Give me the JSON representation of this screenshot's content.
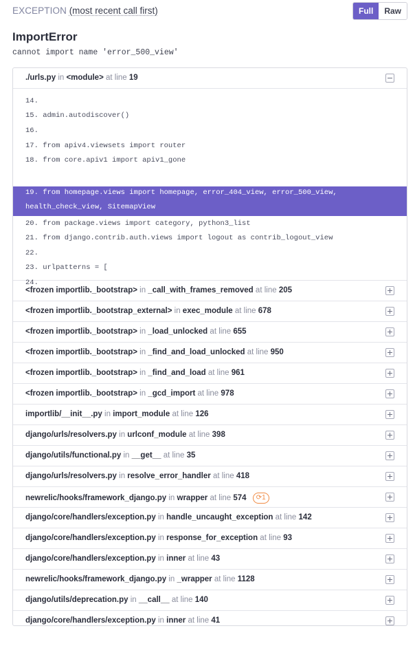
{
  "header": {
    "exception_label": "EXCEPTION",
    "sub_label": "(most recent call first)",
    "toggle_full": "Full",
    "toggle_raw": "Raw"
  },
  "error": {
    "type": "ImportError",
    "message": "cannot import name 'error_500_view'"
  },
  "colors": {
    "accent": "#6c5fc7",
    "badge": "#f08a43",
    "border": "#d9dae0"
  },
  "frames": [
    {
      "file": "./urls.py",
      "in": "in",
      "func": "<module>",
      "at": "at line",
      "line": "19",
      "expanded": true
    },
    {
      "file": "<frozen importlib._bootstrap>",
      "in": "in",
      "func": "_call_with_frames_removed",
      "at": "at line",
      "line": "205"
    },
    {
      "file": "<frozen importlib._bootstrap_external>",
      "in": "in",
      "func": "exec_module",
      "at": "at line",
      "line": "678"
    },
    {
      "file": "<frozen importlib._bootstrap>",
      "in": "in",
      "func": "_load_unlocked",
      "at": "at line",
      "line": "655"
    },
    {
      "file": "<frozen importlib._bootstrap>",
      "in": "in",
      "func": "_find_and_load_unlocked",
      "at": "at line",
      "line": "950"
    },
    {
      "file": "<frozen importlib._bootstrap>",
      "in": "in",
      "func": "_find_and_load",
      "at": "at line",
      "line": "961"
    },
    {
      "file": "<frozen importlib._bootstrap>",
      "in": "in",
      "func": "_gcd_import",
      "at": "at line",
      "line": "978"
    },
    {
      "file": "importlib/__init__.py",
      "in": "in",
      "func": "import_module",
      "at": "at line",
      "line": "126"
    },
    {
      "file": "django/urls/resolvers.py",
      "in": "in",
      "func": "urlconf_module",
      "at": "at line",
      "line": "398"
    },
    {
      "file": "django/utils/functional.py",
      "in": "in",
      "func": "__get__",
      "at": "at line",
      "line": "35"
    },
    {
      "file": "django/urls/resolvers.py",
      "in": "in",
      "func": "resolve_error_handler",
      "at": "at line",
      "line": "418"
    },
    {
      "file": "newrelic/hooks/framework_django.py",
      "in": "in",
      "func": "wrapper",
      "at": "at line",
      "line": "574",
      "badge": "1"
    },
    {
      "file": "django/core/handlers/exception.py",
      "in": "in",
      "func": "handle_uncaught_exception",
      "at": "at line",
      "line": "142"
    },
    {
      "file": "django/core/handlers/exception.py",
      "in": "in",
      "func": "response_for_exception",
      "at": "at line",
      "line": "93"
    },
    {
      "file": "django/core/handlers/exception.py",
      "in": "in",
      "func": "inner",
      "at": "at line",
      "line": "43"
    },
    {
      "file": "newrelic/hooks/framework_django.py",
      "in": "in",
      "func": "_wrapper",
      "at": "at line",
      "line": "1128"
    },
    {
      "file": "django/utils/deprecation.py",
      "in": "in",
      "func": "__call__",
      "at": "at line",
      "line": "140"
    },
    {
      "file": "django/core/handlers/exception.py",
      "in": "in",
      "func": "inner",
      "at": "at line",
      "line": "41"
    }
  ],
  "code": {
    "lines": [
      "14.",
      "15. admin.autodiscover()",
      "16.",
      "17. from apiv4.viewsets import router",
      "18. from core.apiv1 import apiv1_gone"
    ],
    "active_line_a": "19. from homepage.views import homepage, error_404_view, error_500_view,",
    "active_line_b": "health_check_view, SitemapView",
    "lines_after": [
      "20. from package.views import category, python3_list",
      "21. from django.contrib.auth.views import logout as contrib_logout_view",
      "22.",
      "23. urlpatterns = [",
      "24."
    ]
  }
}
